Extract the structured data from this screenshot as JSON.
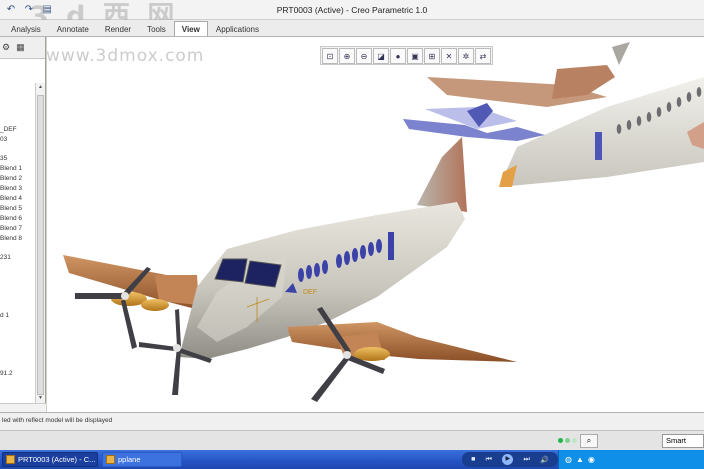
{
  "window": {
    "title": "PRT0003 (Active) - Creo Parametric 1.0",
    "watermark": "3 d 西 网",
    "watermark_url": "www.3dmox.com"
  },
  "quick_access": [
    {
      "icon": "undo-icon",
      "glyph": "↶"
    },
    {
      "icon": "redo-icon",
      "glyph": "↷"
    },
    {
      "icon": "folder-icon",
      "glyph": "▤"
    }
  ],
  "ribbon": {
    "tabs": [
      {
        "label": "Analysis",
        "active": false
      },
      {
        "label": "Annotate",
        "active": false
      },
      {
        "label": "Render",
        "active": false
      },
      {
        "label": "Tools",
        "active": false
      },
      {
        "label": "View",
        "active": true
      },
      {
        "label": "Applications",
        "active": false
      }
    ]
  },
  "left_panel": {
    "toolbar": [
      {
        "icon": "tree-filter-icon",
        "glyph": "⚙"
      },
      {
        "icon": "columns-icon",
        "glyph": "▦"
      }
    ],
    "tree_items": [
      "_DEF",
      "03",
      "35",
      "Blend 1",
      "Blend 2",
      "Blend 3",
      "Blend 4",
      "Blend 5",
      "Blend 6",
      "Blend 7",
      "Blend 8",
      "231",
      "d 1",
      "91.2"
    ]
  },
  "view_toolbar": [
    {
      "icon": "refit-icon",
      "glyph": "⊡"
    },
    {
      "icon": "zoom-in-icon",
      "glyph": "⊕"
    },
    {
      "icon": "zoom-out-icon",
      "glyph": "⊖"
    },
    {
      "icon": "repaint-icon",
      "glyph": "◪"
    },
    {
      "icon": "display-style-icon",
      "glyph": "●"
    },
    {
      "icon": "saved-views-icon",
      "glyph": "▣"
    },
    {
      "icon": "view-manager-icon",
      "glyph": "⊞"
    },
    {
      "icon": "datum-display-icon",
      "glyph": "✕"
    },
    {
      "icon": "spin-center-icon",
      "glyph": "✲"
    },
    {
      "icon": "annotation-display-icon",
      "glyph": "⇄"
    }
  ],
  "model_labels": {
    "csys": "DEF"
  },
  "status": {
    "message": "led with reflect model will be displayed",
    "filter_value": "Smart"
  },
  "taskbar": {
    "items": [
      {
        "label": "PRT0003 (Active) - C..."
      },
      {
        "label": "pplane"
      }
    ],
    "media_controls": [
      "■",
      "⏮",
      "▶",
      "⏭",
      "🔊"
    ],
    "tray_icons": [
      "◍",
      "▲",
      "◉"
    ]
  },
  "colors": {
    "fuselage": "#c9c7bd",
    "wing": "#b87745",
    "engine": "#d79a2a",
    "window": "#3b43a8",
    "taskbar": "#2454c4",
    "led_green": "#22b34a"
  }
}
